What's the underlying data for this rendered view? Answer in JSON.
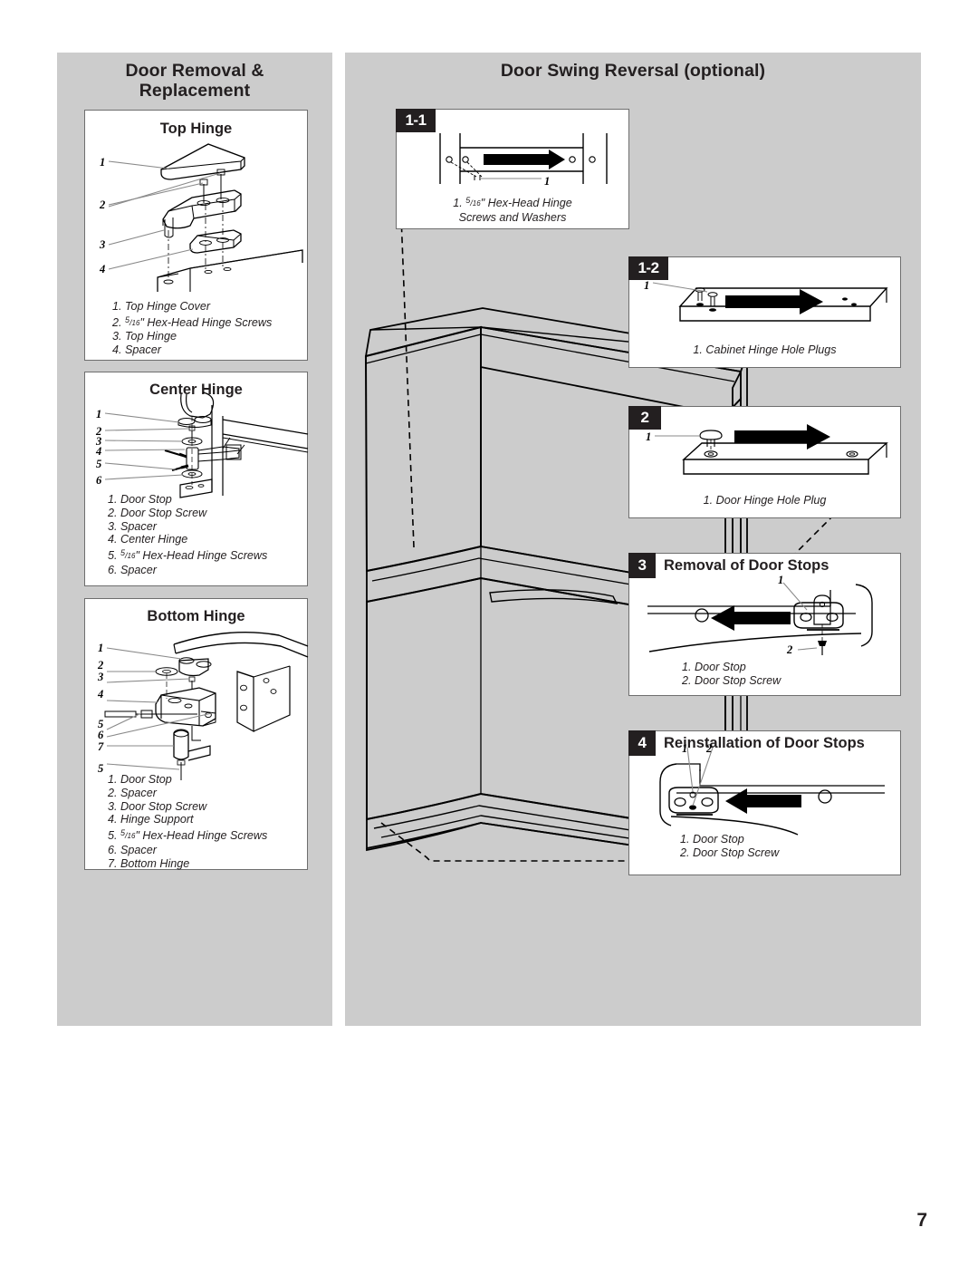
{
  "page": {
    "number": "7"
  },
  "left_column": {
    "heading_line1": "Door Removal &",
    "heading_line2": "Replacement",
    "boxes": [
      {
        "title": "Top Hinge",
        "callout_numbers": [
          "1",
          "2",
          "3",
          "4"
        ],
        "caption": [
          "1. Top Hinge Cover",
          "2. 5/16\" Hex-Head Hinge Screws",
          "3. Top Hinge",
          "4. Spacer"
        ]
      },
      {
        "title": "Center Hinge",
        "callout_numbers": [
          "1",
          "2",
          "3",
          "4",
          "5",
          "6"
        ],
        "caption": [
          "1. Door Stop",
          "2. Door Stop Screw",
          "3. Spacer",
          "4. Center Hinge",
          "5. 5/16\" Hex-Head Hinge Screws",
          "6. Spacer"
        ]
      },
      {
        "title": "Bottom Hinge",
        "callout_numbers": [
          "1",
          "2",
          "3",
          "4",
          "5",
          "6",
          "7",
          "5"
        ],
        "caption": [
          "1. Door Stop",
          "2. Spacer",
          "3. Door Stop Screw",
          "4. Hinge Support",
          "5. 5/16\" Hex-Head Hinge Screws",
          "6. Spacer",
          "7. Bottom Hinge"
        ]
      }
    ]
  },
  "right_column": {
    "heading": "Door Swing Reversal (optional)",
    "panels": [
      {
        "badge": "1-1",
        "title": "",
        "callout_numbers": [
          "1"
        ],
        "caption_line1": "1. 5/16\" Hex-Head Hinge",
        "caption_line2": "Screws and Washers"
      },
      {
        "badge": "1-2",
        "title": "",
        "callout_numbers": [
          "1"
        ],
        "caption_line1": "1. Cabinet Hinge Hole Plugs",
        "caption_line2": ""
      },
      {
        "badge": "2",
        "title": "",
        "callout_numbers": [
          "1"
        ],
        "caption_line1": "1. Door Hinge Hole Plug",
        "caption_line2": ""
      },
      {
        "badge": "3",
        "title": "Removal of Door Stops",
        "callout_numbers": [
          "1",
          "2"
        ],
        "caption_line1": "1. Door Stop",
        "caption_line2": "2. Door Stop Screw"
      },
      {
        "badge": "4",
        "title": "Reinstallation of Door Stops",
        "callout_numbers": [
          "1",
          "2"
        ],
        "caption_line1": "1. Door Stop",
        "caption_line2": "2. Door Stop Screw"
      }
    ]
  },
  "colors": {
    "panel_gray": "#cccccc",
    "badge_black": "#231f20",
    "box_border": "#6e6e6e",
    "text": "#231f20"
  }
}
